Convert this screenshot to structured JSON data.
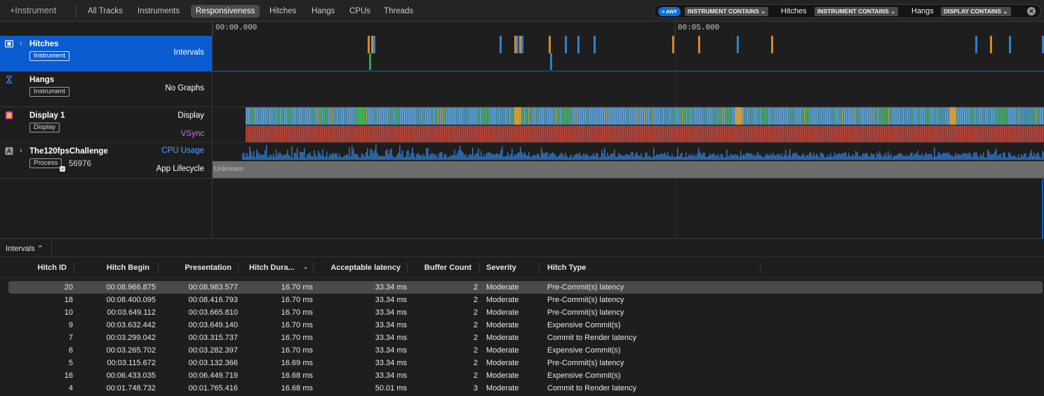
{
  "toolbar": {
    "instrument_label": "+Instrument",
    "scopes": [
      "All Tracks",
      "Instruments",
      "Responsiveness",
      "Hitches",
      "Hangs",
      "CPUs",
      "Threads"
    ],
    "active_scope": "Responsiveness"
  },
  "filter": {
    "any_label": "ANY",
    "tokens": [
      {
        "field": "INSTRUMENT CONTAINS",
        "value": "Hitches"
      },
      {
        "field": "INSTRUMENT CONTAINS",
        "value": "Hangs"
      },
      {
        "field": "DISPLAY CONTAINS",
        "value": ""
      }
    ]
  },
  "ruler": {
    "t0": "00:00.000",
    "t1": "00:05.000"
  },
  "tracks": [
    {
      "name": "Hitches",
      "badge": "Instrument",
      "label": "Intervals",
      "icon": "film-icon",
      "selected": true
    },
    {
      "name": "Hangs",
      "badge": "Instrument",
      "label": "No Graphs",
      "icon": "hourglass-icon"
    },
    {
      "name": "Display 1",
      "badge": "Display",
      "label": "Display",
      "label2": "VSync",
      "icon": "display-icon"
    },
    {
      "name": "The120fpsChallenge",
      "badge": "Process",
      "pid": "56976",
      "label": "CPU Usage",
      "label2": "App Lifecycle",
      "lifecycle_state": "Unknown",
      "icon": "app-icon"
    }
  ],
  "intervals_menu": "Intervals ⌃",
  "table": {
    "columns": [
      "Hitch ID",
      "Hitch Begin",
      "Presentation",
      "Hitch Dura...",
      "Acceptable latency",
      "Buffer Count",
      "Severity",
      "Hitch Type"
    ],
    "rows": [
      [
        "20",
        "00:08.966.875",
        "00:08.983.577",
        "16.70 ms",
        "33.34 ms",
        "2",
        "Moderate",
        "Pre-Commit(s) latency"
      ],
      [
        "18",
        "00:08.400.095",
        "00:08.416.793",
        "16.70 ms",
        "33.34 ms",
        "2",
        "Moderate",
        "Pre-Commit(s) latency"
      ],
      [
        "10",
        "00:03.649.112",
        "00:03.665.810",
        "16.70 ms",
        "33.34 ms",
        "2",
        "Moderate",
        "Pre-Commit(s) latency"
      ],
      [
        "9",
        "00:03.632.442",
        "00:03.649.140",
        "16.70 ms",
        "33.34 ms",
        "2",
        "Moderate",
        "Expensive Commit(s)"
      ],
      [
        "7",
        "00:03.299.042",
        "00:03.315.737",
        "16.70 ms",
        "33.34 ms",
        "2",
        "Moderate",
        "Commit to Render latency"
      ],
      [
        "6",
        "00:03.265.702",
        "00:03.282.397",
        "16.70 ms",
        "33.34 ms",
        "2",
        "Moderate",
        "Expensive Commit(s)"
      ],
      [
        "5",
        "00:03.115.672",
        "00:03.132.366",
        "16.69 ms",
        "33.34 ms",
        "2",
        "Moderate",
        "Pre-Commit(s) latency"
      ],
      [
        "16",
        "00:06.433.035",
        "00:06.449.719",
        "16.68 ms",
        "33.34 ms",
        "2",
        "Moderate",
        "Expensive Commit(s)"
      ],
      [
        "4",
        "00:01.748.732",
        "00:01.765.416",
        "16.68 ms",
        "50.01 ms",
        "3",
        "Moderate",
        "Commit to Render latency"
      ]
    ]
  },
  "colors": {
    "accent": "#0b5cd0",
    "hitch_blue": "#2f7fd6",
    "hitch_orange": "#d08a2e",
    "hitch_green": "#2fa84a",
    "vsync_red": "#c44a3c",
    "vsync_label": "#d070e0",
    "cpu_label": "#4fa3ff"
  }
}
